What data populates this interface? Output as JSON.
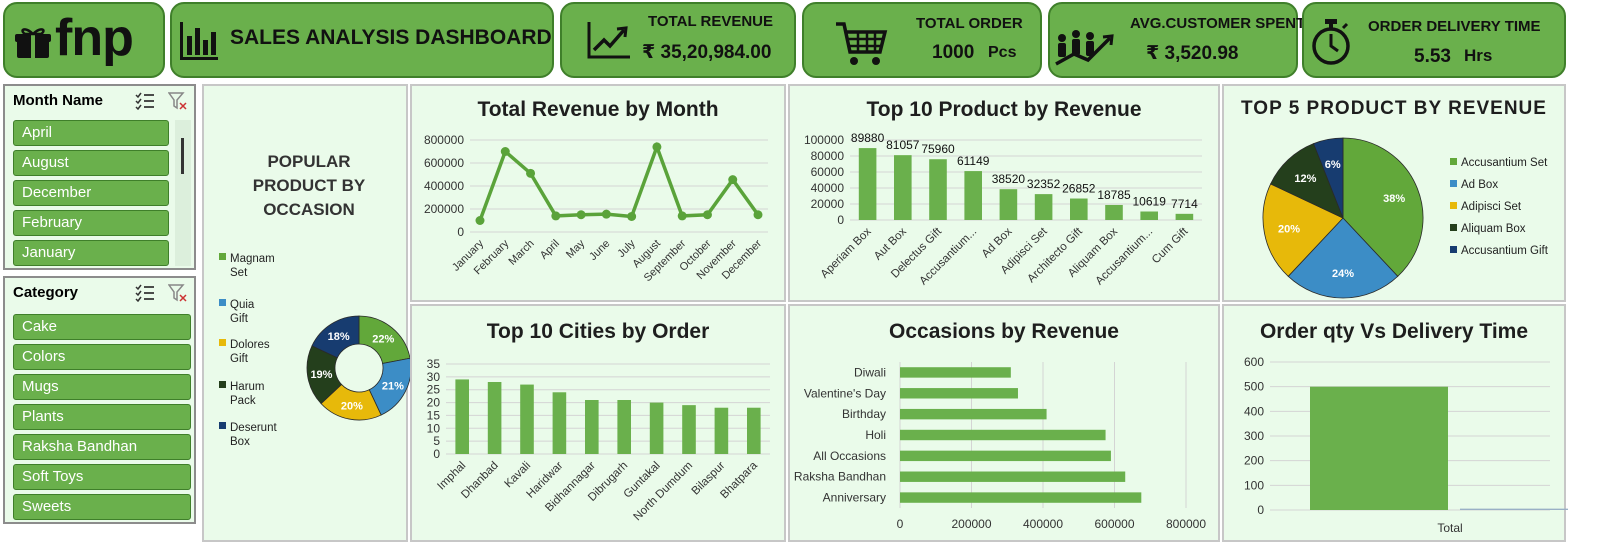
{
  "header": {
    "brand": "fnp",
    "dashboard_title": "SALES ANALYSIS DASHBOARD",
    "kpis": [
      {
        "title": "TOTAL REVENUE",
        "value": "₹ 35,20,984.00",
        "icon": "trend-up-icon"
      },
      {
        "title": "TOTAL ORDER",
        "value": "1000",
        "unit": "Pcs",
        "icon": "shopping-cart-icon"
      },
      {
        "title": "AVG.CUSTOMER SPENT",
        "value": "₹ 3,520.98",
        "icon": "people-growth-icon"
      },
      {
        "title": "ORDER DELIVERY TIME",
        "value": "5.53",
        "unit": "Hrs",
        "icon": "stopwatch-icon"
      }
    ]
  },
  "slicers": {
    "month": {
      "label": "Month Name",
      "items": [
        "April",
        "August",
        "December",
        "February",
        "January"
      ]
    },
    "category": {
      "label": "Category",
      "items": [
        "Cake",
        "Colors",
        "Mugs",
        "Plants",
        "Raksha Bandhan",
        "Soft Toys",
        "Sweets"
      ]
    }
  },
  "colors": {
    "tile": "#6ab04c",
    "bar": "#6ab04c",
    "line": "#5aa33a",
    "panel_bg": "#eafbea",
    "green": "#62a83a",
    "blue": "#3c8dc6",
    "yellow": "#e7b90a",
    "dark_green": "#243f1c",
    "navy": "#173c70"
  },
  "chart_data": [
    {
      "type": "donut",
      "title": "POPULAR PRODUCT BY OCCASION",
      "legend_position": "left",
      "series": [
        {
          "name": "Magnam Set",
          "value": 22,
          "label": "22%",
          "color": "#62a83a"
        },
        {
          "name": "Quia Gift",
          "value": 21,
          "label": "21%",
          "color": "#3c8dc6"
        },
        {
          "name": "Dolores Gift",
          "value": 20,
          "label": "20%",
          "color": "#e7b90a"
        },
        {
          "name": "Harum Pack",
          "value": 19,
          "label": "19%",
          "color": "#243f1c"
        },
        {
          "name": "Deserunt Box",
          "value": 18,
          "label": "18%",
          "color": "#173c70"
        }
      ]
    },
    {
      "type": "line",
      "title": "Total Revenue by Month",
      "categories": [
        "January",
        "February",
        "March",
        "April",
        "May",
        "June",
        "July",
        "August",
        "September",
        "October",
        "November",
        "December"
      ],
      "values": [
        100000,
        700000,
        510000,
        140000,
        150000,
        155000,
        135000,
        740000,
        140000,
        150000,
        455000,
        150000
      ],
      "ylim": [
        0,
        800000
      ],
      "yticks": [
        0,
        200000,
        400000,
        600000,
        800000
      ],
      "grid": true
    },
    {
      "type": "bar",
      "title": "Top 10 Product by Revenue",
      "categories": [
        "Aperiam Box",
        "Aut Box",
        "Delectus Gift",
        "Accusantium...",
        "Ad Box",
        "Adipisci Set",
        "Architecto Gift",
        "Aliquam Box",
        "Accusantium...",
        "Cum Gift"
      ],
      "values": [
        89880,
        81057,
        75960,
        61149,
        38520,
        32352,
        26852,
        18785,
        10619,
        7714
      ],
      "ylim": [
        0,
        100000
      ],
      "yticks": [
        0,
        20000,
        40000,
        60000,
        80000,
        100000
      ],
      "data_labels": true,
      "grid": true
    },
    {
      "type": "pie",
      "title": "TOP 5 PRODUCT BY REVENUE",
      "legend_position": "right",
      "series": [
        {
          "name": "Accusantium Set",
          "value": 38,
          "label": "38%",
          "color": "#62a83a"
        },
        {
          "name": "Ad Box",
          "value": 24,
          "label": "24%",
          "color": "#3c8dc6"
        },
        {
          "name": "Adipisci Set",
          "value": 20,
          "label": "20%",
          "color": "#e7b90a"
        },
        {
          "name": "Aliquam Box",
          "value": 12,
          "label": "12%",
          "color": "#243f1c"
        },
        {
          "name": "Accusantium Gift",
          "value": 6,
          "label": "6%",
          "color": "#173c70"
        }
      ]
    },
    {
      "type": "bar",
      "title": "Top 10 Cities by Order",
      "categories": [
        "Imphal",
        "Dhanbad",
        "Kavali",
        "Haridwar",
        "Bidhannagar",
        "Dibrugarh",
        "Guntakal",
        "North Dumdum",
        "Bilaspur",
        "Bhatpara"
      ],
      "values": [
        29,
        28,
        27,
        24,
        21,
        21,
        20,
        19,
        18,
        18
      ],
      "ylim": [
        0,
        35
      ],
      "yticks": [
        0,
        5,
        10,
        15,
        20,
        25,
        30,
        35
      ],
      "grid": true
    },
    {
      "type": "barh",
      "title": "Occasions by Revenue",
      "categories": [
        "Diwali",
        "Valentine's Day",
        "Birthday",
        "Holi",
        "All Occasions",
        "Raksha Bandhan",
        "Anniversary"
      ],
      "values": [
        310000,
        330000,
        410000,
        575000,
        590000,
        630000,
        675000
      ],
      "xlim": [
        0,
        800000
      ],
      "xticks": [
        0,
        200000,
        400000,
        600000,
        800000
      ],
      "grid": true
    },
    {
      "type": "bar",
      "title": "Order qty Vs Delivery Time",
      "categories": [
        "Total"
      ],
      "series": [
        {
          "values": [
            500
          ]
        },
        {
          "values": [
            5.53
          ]
        }
      ],
      "ylim": [
        0,
        600
      ],
      "yticks": [
        0,
        100,
        200,
        300,
        400,
        500,
        600
      ],
      "grid": true
    }
  ]
}
